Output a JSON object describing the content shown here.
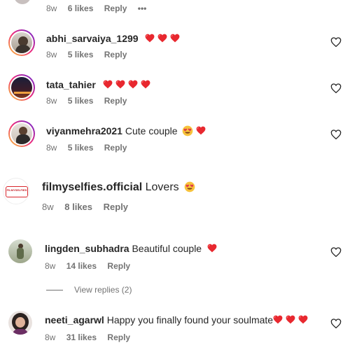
{
  "comments": [
    {
      "user": "",
      "text": "",
      "time": "8w",
      "likes": "6 likes",
      "reply": "Reply",
      "more": "•••"
    },
    {
      "user": "abhi_sarvaiya_1299",
      "text": "",
      "hearts": 3,
      "time": "8w",
      "likes": "5 likes",
      "reply": "Reply"
    },
    {
      "user": "tata_tahier",
      "text": "",
      "hearts": 4,
      "time": "8w",
      "likes": "5 likes",
      "reply": "Reply"
    },
    {
      "user": "viyanmehra2021",
      "text": "Cute couple",
      "love": 1,
      "hearts": 1,
      "time": "8w",
      "likes": "5 likes",
      "reply": "Reply"
    },
    {
      "user": "filmyselfies.official",
      "text": "Lovers",
      "love": 1,
      "time": "8w",
      "likes": "8 likes",
      "reply": "Reply",
      "avatar_text": "FILMYSELFIES"
    },
    {
      "user": "lingden_subhadra",
      "text": "Beautiful couple",
      "hearts": 1,
      "time": "8w",
      "likes": "14 likes",
      "reply": "Reply"
    },
    {
      "user": "neeti_agarwl",
      "text": "Happy you finally found your soulmate",
      "hearts": 3,
      "time": "8w",
      "likes": "31 likes",
      "reply": "Reply"
    }
  ],
  "view_replies": "View replies (2)",
  "colors": {
    "heart": "#ed4956",
    "meta": "#737373",
    "text": "#262626"
  }
}
